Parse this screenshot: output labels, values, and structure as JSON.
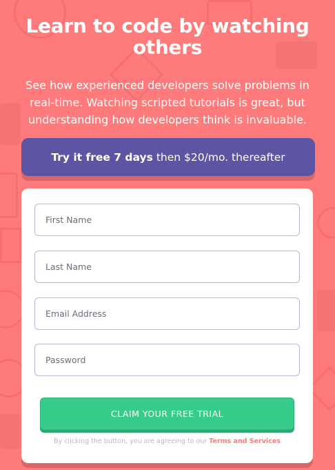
{
  "hero": {
    "title": "Learn to code by watching others",
    "description": "See how experienced developers solve problems in real-time. Watching scripted tutorials is great, but understanding how developers think is invaluable."
  },
  "offer": {
    "highlight": "Try it free 7 days",
    "rest": "then $20/mo. thereafter"
  },
  "form": {
    "first_name_placeholder": "First Name",
    "last_name_placeholder": "Last Name",
    "email_placeholder": "Email Address",
    "password_placeholder": "Password",
    "submit_label": "CLAIM YOUR FREE TRIAL",
    "terms_prefix": "By clicking the button, you are agreeing to our",
    "terms_link": "Terms and Services"
  },
  "colors": {
    "background": "#ff7a7a",
    "banner": "#5e54a4",
    "submit": "#38cc8b",
    "terms_link": "#ff7a7a"
  }
}
